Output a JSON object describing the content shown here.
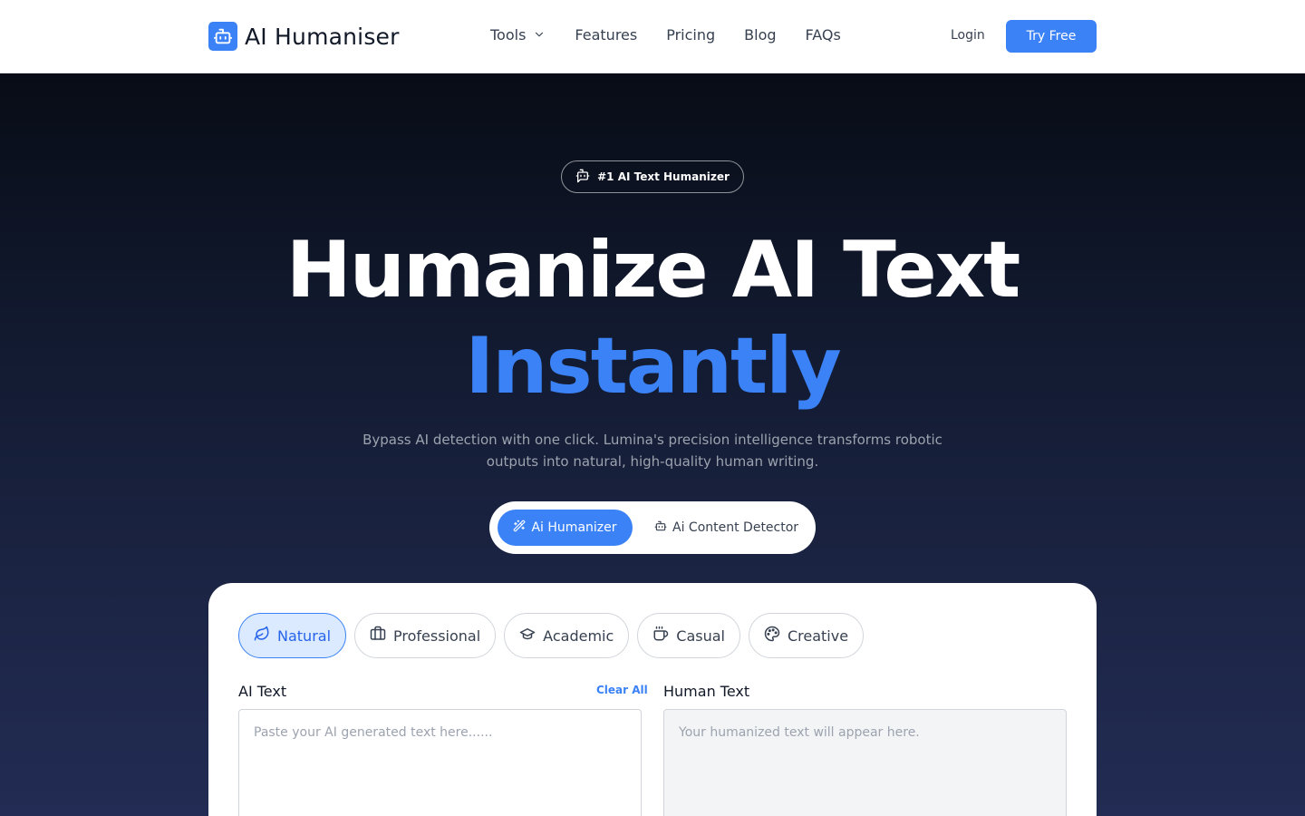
{
  "brand": {
    "name": "AI Humaniser",
    "accent": "#3b82f6"
  },
  "nav": {
    "items": [
      {
        "label": "Tools",
        "has_dropdown": true
      },
      {
        "label": "Features"
      },
      {
        "label": "Pricing"
      },
      {
        "label": "Blog"
      },
      {
        "label": "FAQs"
      }
    ],
    "login": "Login",
    "cta": "Try Free"
  },
  "hero": {
    "badge": "#1 AI Text Humanizer",
    "title_line1": "Humanize AI Text",
    "title_line2": "Instantly",
    "subtitle": "Bypass AI detection with one click. Lumina's precision intelligence transforms robotic outputs into natural, high-quality human writing."
  },
  "modes": {
    "active": "Ai Humanizer",
    "inactive": "Ai Content Detector"
  },
  "tones": [
    {
      "label": "Natural",
      "icon": "leaf-icon",
      "selected": true
    },
    {
      "label": "Professional",
      "icon": "briefcase-icon",
      "selected": false
    },
    {
      "label": "Academic",
      "icon": "graduation-cap-icon",
      "selected": false
    },
    {
      "label": "Casual",
      "icon": "coffee-icon",
      "selected": false
    },
    {
      "label": "Creative",
      "icon": "palette-icon",
      "selected": false
    }
  ],
  "editor": {
    "ai_label": "AI Text",
    "clear_all": "Clear All",
    "ai_placeholder": "Paste your AI generated text here......",
    "ai_value": "",
    "human_label": "Human Text",
    "human_placeholder": "Your humanized text will appear here.",
    "human_value": ""
  }
}
